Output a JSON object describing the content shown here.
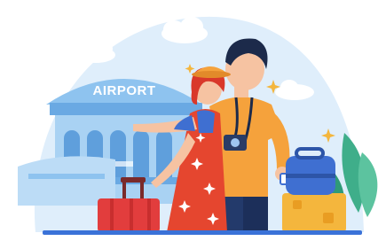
{
  "airport_sign": "AIRPORT",
  "colors": {
    "sky_dome": "#dfeefb",
    "building": "#8ec3ef",
    "building_dark": "#5f9fdc",
    "suitcase_red": "#e23d3d",
    "suitcase_yellow": "#f4b63d",
    "bag_blue": "#3f6fd1",
    "dress_red": "#e5462f",
    "hair_red": "#d9382a",
    "shirt_orange": "#f5a23c",
    "pants_navy": "#233a6b",
    "hair_dark": "#1c2a4a",
    "skin": "#f6c3a2",
    "plant_green": "#3fae8a",
    "ground_blue": "#3a72d8"
  }
}
